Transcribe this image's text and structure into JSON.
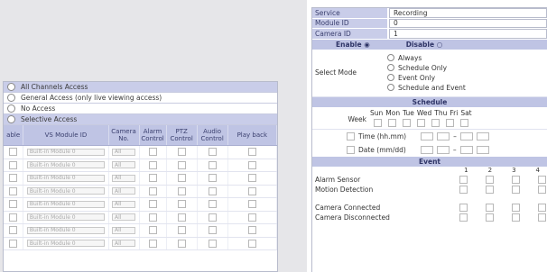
{
  "left_panel": {
    "access_options": [
      {
        "label": "All Channels Access",
        "selected": true
      },
      {
        "label": "General Access (only live viewing access)",
        "selected": false
      },
      {
        "label": "No Access",
        "selected": false
      },
      {
        "label": "Selective Access",
        "selected": false
      }
    ],
    "table_headers": {
      "enable": "able",
      "module": "VS Module ID",
      "camera": "Camera No.",
      "alarm": "Alarm Control",
      "ptz": "PTZ Control",
      "audio": "Audio Control",
      "playback": "Play back"
    },
    "rows": [
      {
        "module": "Built-in Module 0",
        "camera": "All"
      },
      {
        "module": "Built-in Module 0",
        "camera": "All"
      },
      {
        "module": "Built-in Module 0",
        "camera": "All"
      },
      {
        "module": "Built-in Module 0",
        "camera": "All"
      },
      {
        "module": "Built-in Module 0",
        "camera": "All"
      },
      {
        "module": "Built-in Module 0",
        "camera": "All"
      },
      {
        "module": "Built-in Module 0",
        "camera": "All"
      },
      {
        "module": "Built-in Module 0",
        "camera": "All"
      }
    ]
  },
  "right_panel": {
    "fields": [
      {
        "label": "Service",
        "value": "Recording"
      },
      {
        "label": "Module ID",
        "value": "0"
      },
      {
        "label": "Camera ID",
        "value": "1"
      }
    ],
    "enable_label": "Enable",
    "disable_label": "Disable",
    "select_mode_label": "Select Mode",
    "modes": [
      "Always",
      "Schedule Only",
      "Event Only",
      "Schedule and Event"
    ],
    "schedule_title": "Schedule",
    "week_label": "Week",
    "days": [
      "Sun",
      "Mon",
      "Tue",
      "Wed",
      "Thu",
      "Fri",
      "Sat"
    ],
    "time_label": "Time (hh.mm)",
    "date_label": "Date (mm/dd)",
    "event_title": "Event",
    "event_columns": [
      "1",
      "2",
      "3",
      "4"
    ],
    "events": [
      "Alarm Sensor",
      "Motion Detection",
      "Camera Connected",
      "Camera Disconnected"
    ]
  }
}
